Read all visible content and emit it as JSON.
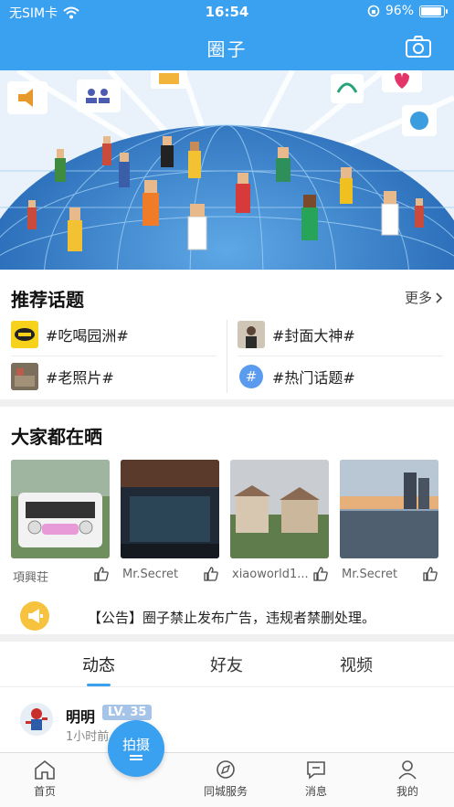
{
  "status_bar": {
    "carrier": "无SIM卡",
    "time": "16:54",
    "battery_percent": "96%",
    "battery_level": 0.96
  },
  "header": {
    "title": "圈子"
  },
  "topics": {
    "title": "推荐话题",
    "more_label": "更多",
    "items": [
      {
        "label": "#吃喝园洲#",
        "thumb": "food-logo"
      },
      {
        "label": "#封面大神#",
        "thumb": "person-photo"
      },
      {
        "label": "#老照片#",
        "thumb": "old-photo"
      },
      {
        "label": "#热门话题#",
        "thumb": "hash-icon"
      }
    ]
  },
  "gallery": {
    "title": "大家都在晒",
    "items": [
      {
        "name": "項興荘",
        "image": "white-jeep"
      },
      {
        "name": "Mr.Secret",
        "image": "dark-interior"
      },
      {
        "name": "xiaoworld1...",
        "image": "villas"
      },
      {
        "name": "Mr.Secret",
        "image": "lake-sunset"
      }
    ]
  },
  "notice": {
    "text": "【公告】圈子禁止发布广告，违规者禁删处理。"
  },
  "feed_tabs": {
    "items": [
      "动态",
      "好友",
      "视频"
    ],
    "active": 0
  },
  "post": {
    "user": "明明",
    "level": "LV. 35",
    "time": "1小时前"
  },
  "tabbar": {
    "shoot_label": "拍摄",
    "items": [
      "首页",
      "同城服务",
      "消息",
      "我的"
    ]
  },
  "colors": {
    "accent": "#3aa0f0",
    "level_badge": "#a6c3e8",
    "notice_horn": "#f7c23d"
  }
}
